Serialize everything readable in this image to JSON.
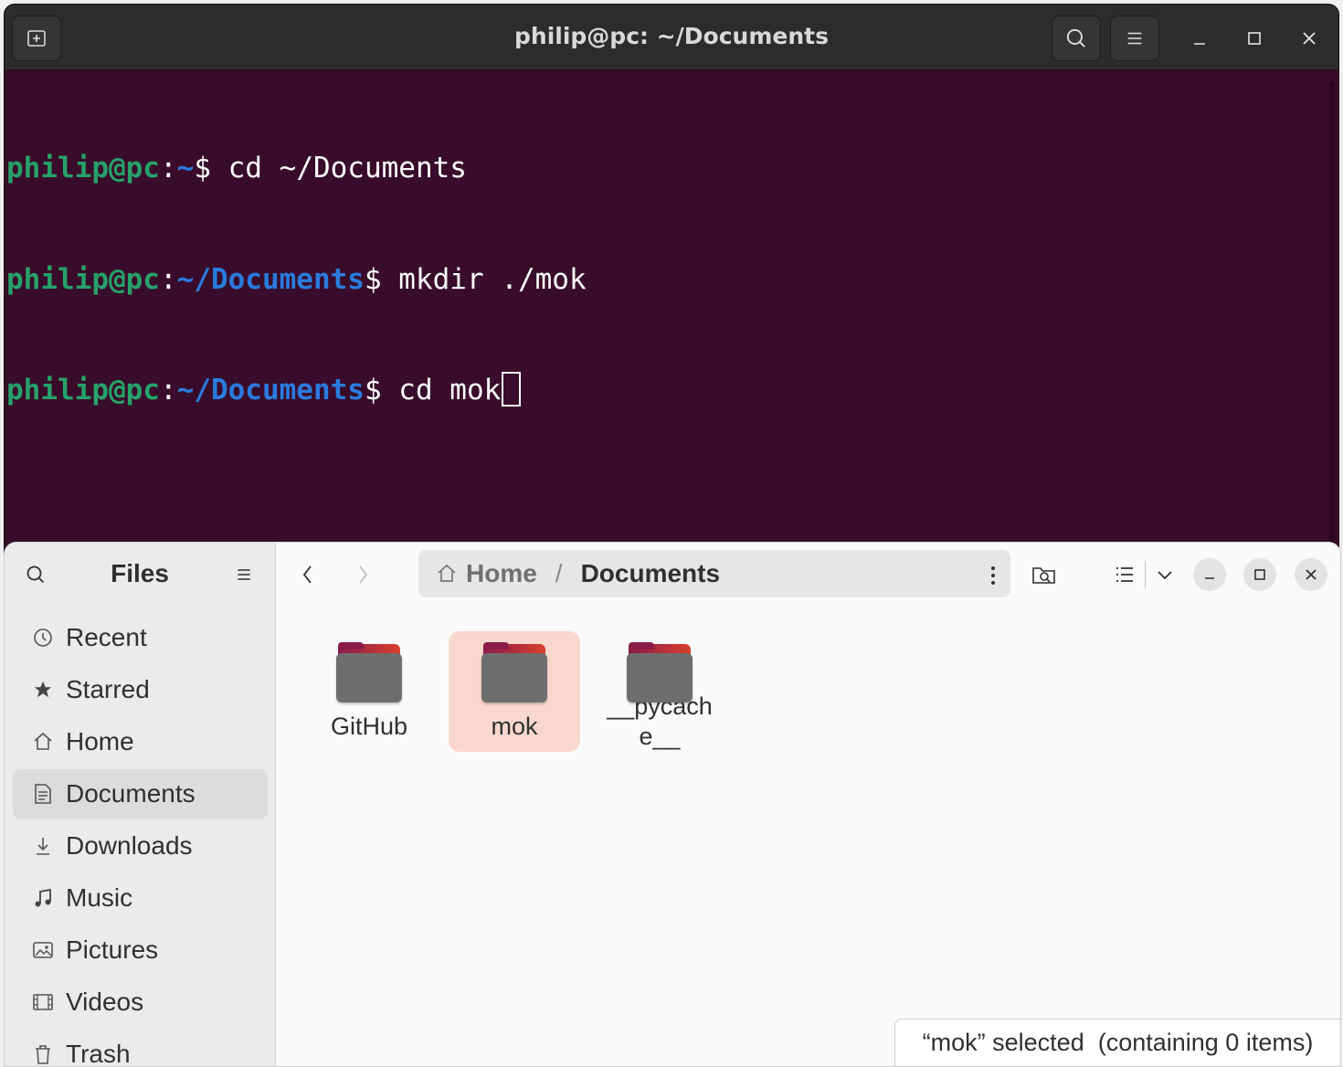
{
  "terminal": {
    "title": "philip@pc: ~/Documents",
    "new_tab_icon": "new-tab-icon",
    "lines": [
      {
        "user": "philip@pc",
        "colon": ":",
        "path": "~",
        "dollar": "$",
        "cmd": " cd ~/Documents"
      },
      {
        "user": "philip@pc",
        "colon": ":",
        "path": "~/Documents",
        "dollar": "$",
        "cmd": " mkdir ./mok"
      },
      {
        "user": "philip@pc",
        "colon": ":",
        "path": "~/Documents",
        "dollar": "$",
        "cmd": " cd mok"
      }
    ],
    "colors": {
      "background": "#380c2a",
      "user": "#26a269",
      "path": "#2a7bde"
    }
  },
  "files": {
    "app_title": "Files",
    "sidebar": {
      "items": [
        {
          "label": "Recent",
          "icon": "clock-icon"
        },
        {
          "label": "Starred",
          "icon": "star-icon"
        },
        {
          "label": "Home",
          "icon": "home-icon"
        },
        {
          "label": "Documents",
          "icon": "document-icon",
          "active": true
        },
        {
          "label": "Downloads",
          "icon": "download-icon"
        },
        {
          "label": "Music",
          "icon": "music-icon"
        },
        {
          "label": "Pictures",
          "icon": "picture-icon"
        },
        {
          "label": "Videos",
          "icon": "video-icon"
        },
        {
          "label": "Trash",
          "icon": "trash-icon"
        }
      ]
    },
    "pathbar": {
      "home": "Home",
      "separator": "/",
      "current": "Documents"
    },
    "items": [
      {
        "label": "GitHub",
        "selected": false
      },
      {
        "label": "mok",
        "selected": true
      },
      {
        "label": "__pycache__",
        "selected": false
      }
    ],
    "status": "“mok” selected  (containing 0 items)",
    "colors": {
      "selection": "#f9d7cc",
      "folder_accent": "#d8402c"
    }
  }
}
